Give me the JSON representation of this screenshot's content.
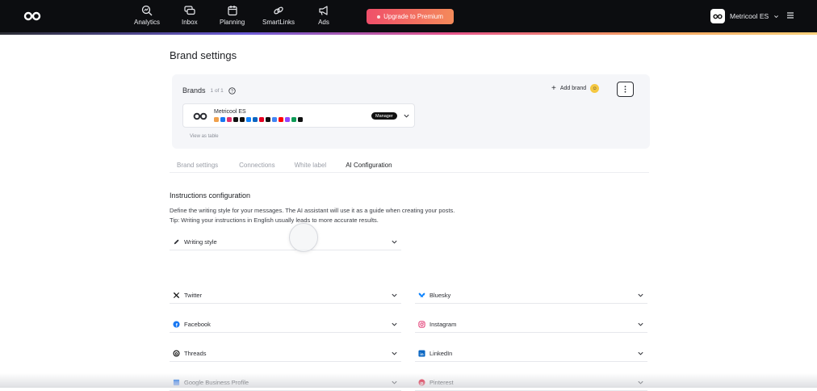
{
  "nav": {
    "items": [
      {
        "label": "Analytics",
        "icon": "analytics-icon"
      },
      {
        "label": "Inbox",
        "icon": "inbox-icon"
      },
      {
        "label": "Planning",
        "icon": "calendar-icon"
      },
      {
        "label": "SmartLinks",
        "icon": "link-icon"
      },
      {
        "label": "Ads",
        "icon": "megaphone-icon"
      }
    ],
    "upgrade_label": "Upgrade to Premium",
    "account_name": "Metricool ES"
  },
  "page": {
    "title": "Brand settings"
  },
  "brands": {
    "title": "Brands",
    "count": "1 of 1",
    "add_label": "Add brand",
    "brand_name": "Metricool ES",
    "role_badge": "Manager",
    "view_as_table": "View as table",
    "network_colors": [
      "#f0a04b",
      "#1877f2",
      "#e1306c",
      "#111111",
      "#111111",
      "#1185fe",
      "#0a66c2",
      "#e60023",
      "#111111",
      "#4285f4",
      "#ff0000",
      "#9146ff",
      "#0f9d58",
      "#111111"
    ]
  },
  "tabs": [
    {
      "label": "Brand settings",
      "active": false
    },
    {
      "label": "Connections",
      "active": false
    },
    {
      "label": "White label",
      "active": false
    },
    {
      "label": "AI Configuration",
      "active": true
    }
  ],
  "ai_config": {
    "section_title": "Instructions configuration",
    "description_line1": "Define the writing style for your messages. The AI assistant will use it as a guide when creating your posts.",
    "description_line2": "Tip: Writing your instructions in English usually leads to more accurate results.",
    "writing_style_label": "Writing style",
    "networks_left": [
      "Twitter",
      "Facebook",
      "Threads",
      "Google Business Profile"
    ],
    "networks_right": [
      "Bluesky",
      "Instagram",
      "LinkedIn",
      "Pinterest"
    ]
  }
}
